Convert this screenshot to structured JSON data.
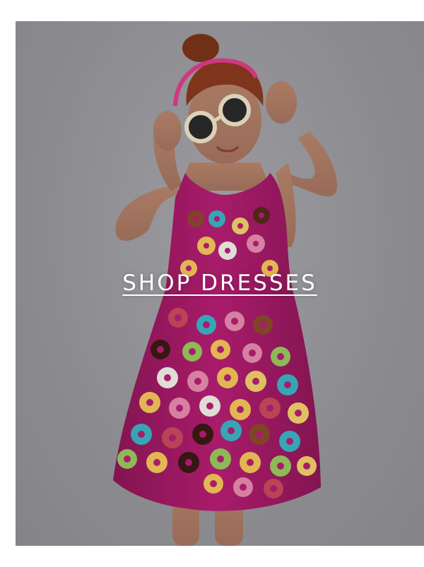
{
  "promo": {
    "cta_label": "SHOP DRESSES",
    "image_subject": "girl-in-donut-print-dress",
    "colors": {
      "background": "#9b9b9f",
      "dress": "#c8237f",
      "text": "#ffffff"
    }
  }
}
